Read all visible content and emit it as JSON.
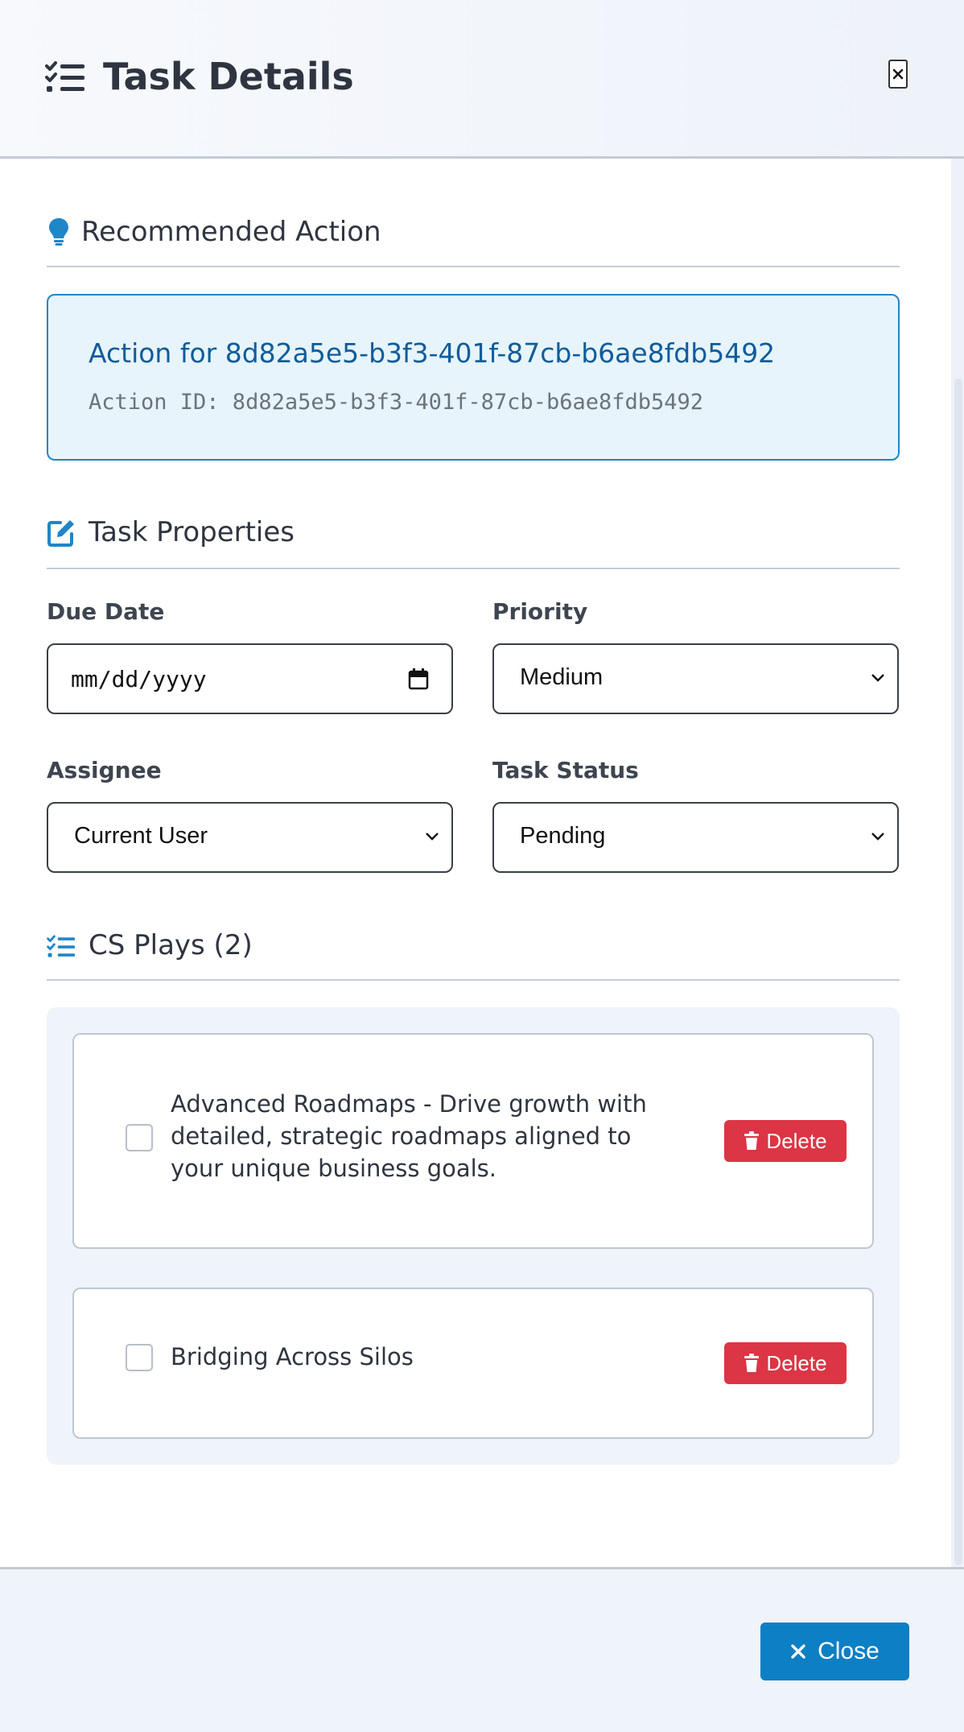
{
  "header": {
    "title": "Task Details",
    "icon": "task-list-icon",
    "close_icon": "close-x-icon"
  },
  "recommended": {
    "heading": "Recommended Action",
    "icon": "lightbulb-icon",
    "title": "Action for 8d82a5e5-b3f3-401f-87cb-b6ae8fdb5492",
    "action_id": "Action ID: 8d82a5e5-b3f3-401f-87cb-b6ae8fdb5492"
  },
  "properties": {
    "heading": "Task Properties",
    "icon": "edit-icon",
    "due_date_label": "Due Date",
    "due_date_placeholder": "mm/dd/yyyy",
    "priority_label": "Priority",
    "priority_value": "Medium",
    "assignee_label": "Assignee",
    "assignee_value": "Current User",
    "status_label": "Task Status",
    "status_value": "Pending"
  },
  "plays": {
    "heading": "CS Plays (2)",
    "icon": "checklist-icon",
    "items": [
      {
        "text": "Advanced Roadmaps - Drive growth with detailed, strategic roadmaps aligned to your unique business goals.",
        "delete_label": "Delete"
      },
      {
        "text": "Bridging Across Silos",
        "delete_label": "Delete"
      }
    ]
  },
  "footer": {
    "close_label": "Close"
  },
  "colors": {
    "accent": "#0d7fc4",
    "danger": "#dc3545",
    "link": "#0f5c9a"
  }
}
